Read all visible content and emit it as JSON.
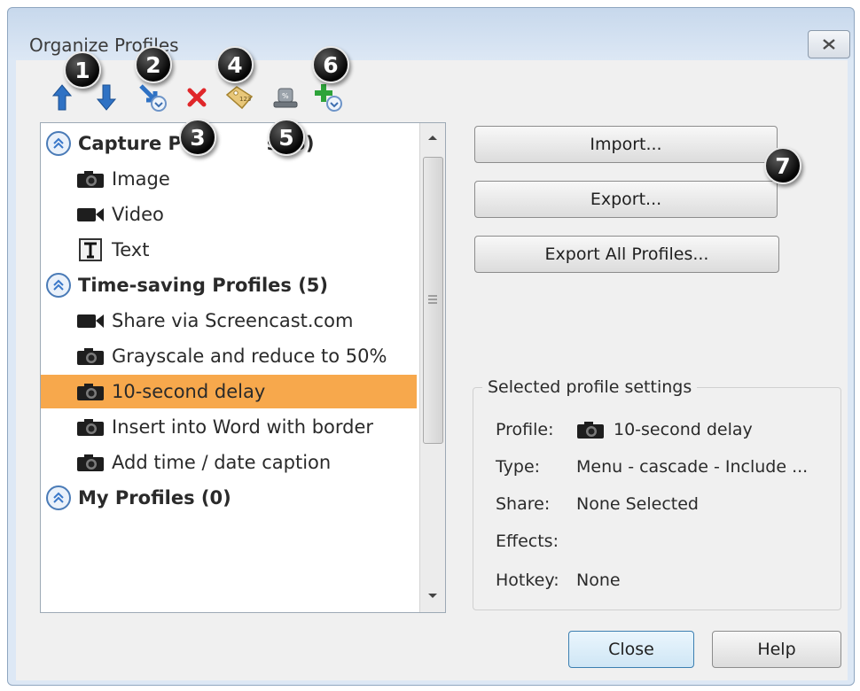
{
  "window": {
    "title": "Organize Profiles"
  },
  "toolbar": {
    "buttons": [
      {
        "icon": "move-up-arrow-icon",
        "callout": "1"
      },
      {
        "icon": "move-down-arrow-icon",
        "callout": ""
      },
      {
        "icon": "arrow-down-right-icon",
        "callout": "2"
      },
      {
        "icon": "delete-x-icon",
        "callout": "3"
      },
      {
        "icon": "tag-icon",
        "callout": "4"
      },
      {
        "icon": "hat-icon",
        "callout": "5"
      },
      {
        "icon": "add-plus-icon",
        "callout": "6"
      }
    ]
  },
  "callouts": [
    "1",
    "2",
    "3",
    "4",
    "5",
    "6",
    "7"
  ],
  "tree": {
    "groups": [
      {
        "label": "Capture Profiles (3)",
        "display": "Capture P",
        "display_after": "s (3)",
        "items": [
          {
            "icon": "camera-icon",
            "label": "Image"
          },
          {
            "icon": "video-camera-icon",
            "label": "Video"
          },
          {
            "icon": "text-t-icon",
            "label": "Text"
          }
        ]
      },
      {
        "label": "Time-saving Profiles (5)",
        "items": [
          {
            "icon": "video-camera-icon",
            "label": "Share via Screencast.com"
          },
          {
            "icon": "camera-icon",
            "label": "Grayscale and reduce to 50%"
          },
          {
            "icon": "camera-icon",
            "label": "10-second delay",
            "selected": true
          },
          {
            "icon": "camera-icon",
            "label": "Insert into Word with border"
          },
          {
            "icon": "camera-icon",
            "label": "Add time / date caption"
          }
        ]
      },
      {
        "label": "My Profiles (0)",
        "items": []
      }
    ]
  },
  "buttons": {
    "import": "Import...",
    "export": "Export...",
    "export_all": "Export All Profiles...",
    "close": "Close",
    "help": "Help"
  },
  "settings": {
    "title": "Selected profile settings",
    "profile_label": "Profile:",
    "profile_value": "10-second delay",
    "type_label": "Type:",
    "type_value": "Menu - cascade - Include ...",
    "share_label": "Share:",
    "share_value": "None Selected",
    "effects_label": "Effects:",
    "effects_value": "",
    "hotkey_label": "Hotkey:",
    "hotkey_value": "None"
  },
  "colors": {
    "selection": "#f7a84c",
    "accent": "#3a78c9"
  }
}
